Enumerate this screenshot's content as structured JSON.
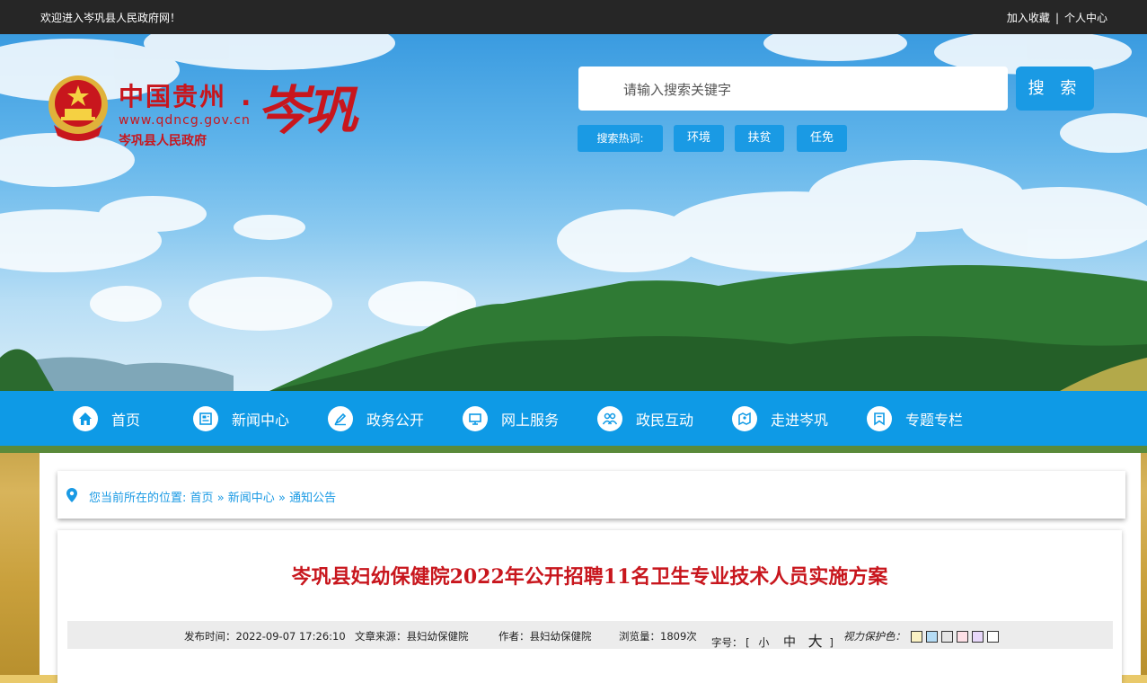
{
  "topbar": {
    "welcome": "欢迎进入岑巩县人民政府网！",
    "bookmark": "加入收藏",
    "separator": "|",
    "personal_center": "个人中心"
  },
  "logo": {
    "title": "中国贵州",
    "dot": ".",
    "url": "www.qdncg.gov.cn",
    "subtitle": "岑巩县人民政府",
    "calligraphy": "岑巩"
  },
  "search": {
    "placeholder": "请输入搜索关键字",
    "button": "搜 索",
    "hot_label": "搜索热词:",
    "hot_words": [
      "环境",
      "扶贫",
      "任免"
    ]
  },
  "nav": {
    "items": [
      {
        "label": "首页",
        "icon": "home-icon"
      },
      {
        "label": "新闻中心",
        "icon": "newspaper-icon"
      },
      {
        "label": "政务公开",
        "icon": "pen-icon"
      },
      {
        "label": "网上服务",
        "icon": "monitor-icon"
      },
      {
        "label": "政民互动",
        "icon": "people-icon"
      },
      {
        "label": "走进岑巩",
        "icon": "map-icon"
      },
      {
        "label": "专题专栏",
        "icon": "bookmark-icon"
      }
    ]
  },
  "breadcrumb": {
    "prefix": "您当前所在的位置:",
    "items": [
      "首页",
      "新闻中心",
      "通知公告"
    ],
    "separator": "»"
  },
  "article": {
    "title": "岑巩县妇幼保健院2022年公开招聘11名卫生专业技术人员实施方案",
    "publish_time_label": "发布时间：",
    "publish_time": "2022-09-07 17:26:10",
    "source_label": "文章来源：",
    "source": "县妇幼保健院",
    "author_label": "作者：",
    "author": "县妇幼保健院",
    "views_label": "浏览量：",
    "views": "1809次",
    "font_size_label": "字号：",
    "bracket_open": "[",
    "bracket_close": "]",
    "font_small": "小",
    "font_medium": "中",
    "font_large": "大",
    "eye_protect_label": "视力保护色：",
    "eye_colors": [
      "#fbf2c4",
      "#b5dcf5",
      "#e6e6e6",
      "#fde0e6",
      "#e8d8fa",
      "#ffffff"
    ]
  }
}
